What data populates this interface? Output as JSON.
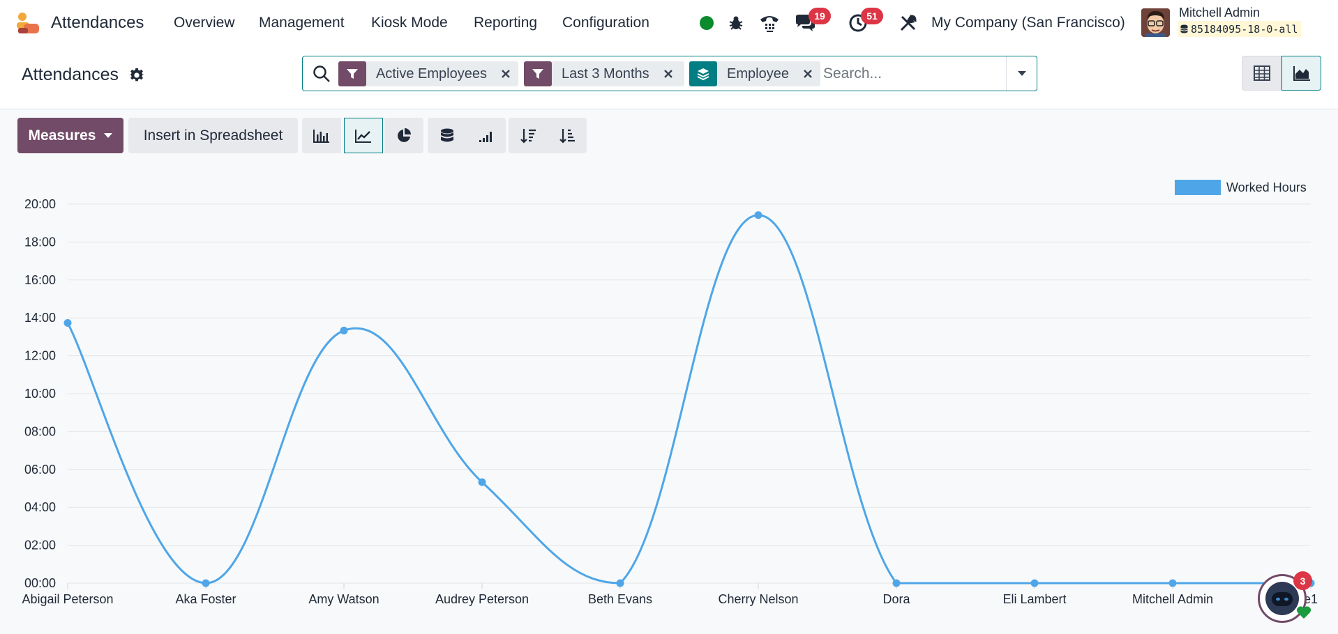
{
  "navbar": {
    "app_name": "Attendances",
    "menus": [
      "Overview",
      "Management",
      "Kiosk Mode",
      "Reporting",
      "Configuration"
    ],
    "messages_count": "19",
    "activities_count": "51",
    "company": "My Company (San Francisco)",
    "user_name": "Mitchell Admin",
    "database": "85184095-18-0-all"
  },
  "control_panel": {
    "title": "Attendances",
    "facets": [
      "Active Employees",
      "Last 3 Months",
      "Employee"
    ],
    "search_placeholder": "Search..."
  },
  "toolbar": {
    "measures_label": "Measures",
    "insert_label": "Insert in Spreadsheet"
  },
  "colors": {
    "brand": "#714b67",
    "accent": "#017e84",
    "line": "#4ea6e8",
    "badge": "#dc3545"
  },
  "chat": {
    "count": "3"
  },
  "chart_data": {
    "type": "line",
    "categories": [
      "Abigail Peterson",
      "Aka Foster",
      "Amy Watson",
      "Audrey Peterson",
      "Beth Evans",
      "Cherry Nelson",
      "Dora",
      "Eli Lambert",
      "Mitchell Admin",
      "e1"
    ],
    "series": [
      {
        "name": "Worked Hours",
        "values": [
          13.73,
          0,
          13.33,
          5.33,
          0,
          19.42,
          0,
          0,
          0,
          0
        ]
      }
    ],
    "ylim": [
      0,
      20
    ],
    "yticks": [
      "00:00",
      "02:00",
      "04:00",
      "06:00",
      "08:00",
      "10:00",
      "12:00",
      "14:00",
      "16:00",
      "18:00",
      "20:00"
    ],
    "legend_position": "top-right",
    "grid": true
  }
}
